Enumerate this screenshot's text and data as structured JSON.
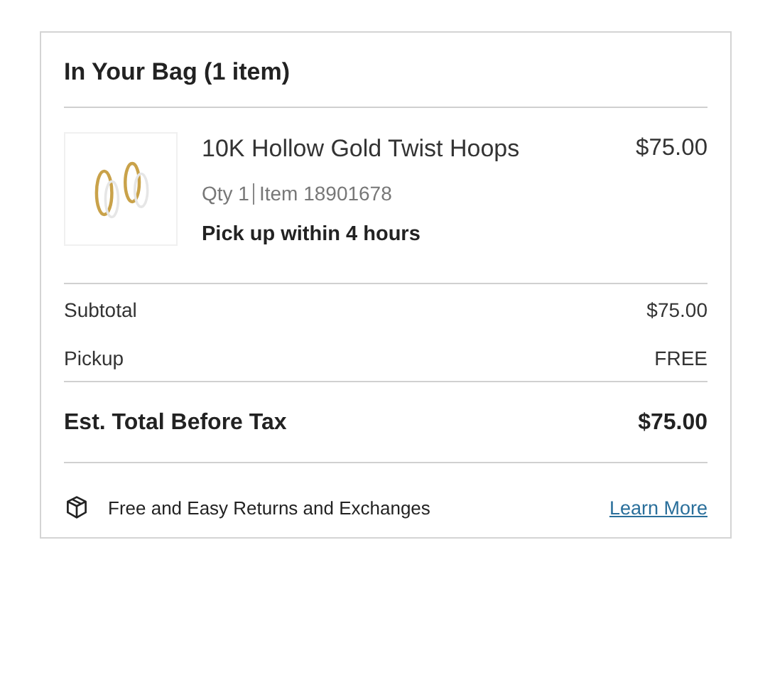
{
  "bag": {
    "title": "In Your Bag (1 item)",
    "items": [
      {
        "name": "10K Hollow Gold Twist Hoops",
        "price": "$75.00",
        "qty": "Qty 1",
        "item_number": "Item 18901678",
        "fulfillment": "Pick up within 4 hours"
      }
    ],
    "summary": [
      {
        "label": "Subtotal",
        "value": "$75.00"
      },
      {
        "label": "Pickup",
        "value": "FREE"
      }
    ],
    "total": {
      "label": "Est. Total Before Tax",
      "value": "$75.00"
    },
    "returns": {
      "text": "Free and Easy Returns and Exchanges",
      "link": "Learn More"
    }
  }
}
